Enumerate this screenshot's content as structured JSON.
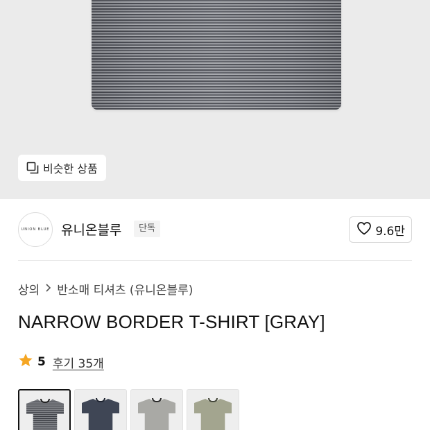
{
  "hero": {
    "similar_label": "비슷한 상품",
    "similar_icon": "copy-icon"
  },
  "brand": {
    "logo_text": "UNION BLUE",
    "name": "유니온블루",
    "badge": "단독",
    "likes": "9.6만",
    "like_icon": "heart-outline-icon"
  },
  "breadcrumb": [
    {
      "label": "상의"
    },
    {
      "label": "반소매 티셔츠 (유니온블루)"
    }
  ],
  "product": {
    "title": "NARROW BORDER T-SHIRT [GRAY]"
  },
  "rating": {
    "score": "5",
    "review_label": "후기 35개",
    "star_color": "#f5a623"
  },
  "color_options": [
    {
      "name": "gray-stripe",
      "color": "#7d7f84",
      "stripe": "#3e4046",
      "neck": "#222222",
      "selected": true
    },
    {
      "name": "navy",
      "color": "#3f4655",
      "stripe": null,
      "neck": "#1e2430",
      "selected": false
    },
    {
      "name": "light-gray",
      "color": "#a9a9a5",
      "stripe": null,
      "neck": "#2a2a2a",
      "selected": false
    },
    {
      "name": "olive",
      "color": "#a3a58f",
      "stripe": null,
      "neck": "#44473a",
      "selected": false
    }
  ]
}
